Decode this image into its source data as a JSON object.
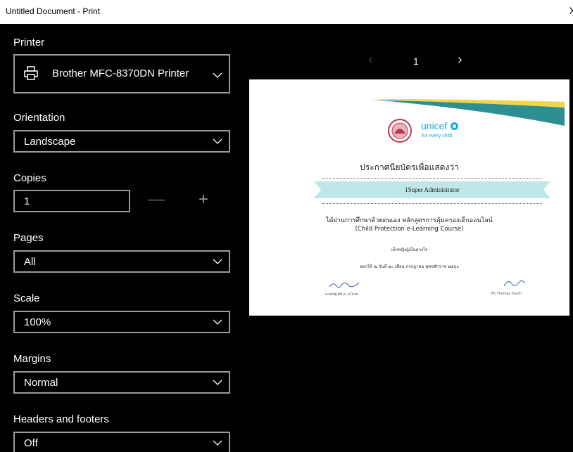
{
  "window": {
    "title": "Untitled Document - Print",
    "close_glyph": "X"
  },
  "settings": {
    "printer": {
      "label": "Printer",
      "value": "Brother MFC-8370DN Printer",
      "icon": "printer-icon"
    },
    "orientation": {
      "label": "Orientation",
      "value": "Landscape"
    },
    "copies": {
      "label": "Copies",
      "value": "1",
      "minus": "—",
      "plus": "+"
    },
    "pages": {
      "label": "Pages",
      "value": "All"
    },
    "scale": {
      "label": "Scale",
      "value": "100%"
    },
    "margins": {
      "label": "Margins",
      "value": "Normal"
    },
    "headers_footers": {
      "label": "Headers and footers",
      "value": "Off"
    }
  },
  "preview": {
    "page_number": "1",
    "prev_glyph": "‹",
    "next_glyph": "›",
    "certificate": {
      "logo_text": "unicef",
      "logo_tagline": "for every child",
      "title": "ประกาศนียบัตรเพื่อแสดงว่า",
      "recipient": "1Super Administrator",
      "line1": "ได้ผ่านการศึกษาด้วยตนเอง หลักสูตรการคุ้มครองเด็กออนไลน์",
      "line2": "(Child Protection e-Learning Course)",
      "sub": "เด็กหญิงผู้เป็นดวงใจ",
      "issued": "ออกให้ ณ วันที่ ๒๐ เดือน กรกฎาคม พุทธศักราช ๒๕๖๐",
      "signer_left": "นายณัฐวุฒิ ณ มโนรม",
      "signer_right": "Mr.Thomas Davin"
    }
  },
  "colors": {
    "unicef_blue": "#1cabe2",
    "banner": "#bfe7ea",
    "swoosh_teal": "#2d8f92",
    "swoosh_yellow": "#f1d44a",
    "seal": "#c0354a"
  }
}
